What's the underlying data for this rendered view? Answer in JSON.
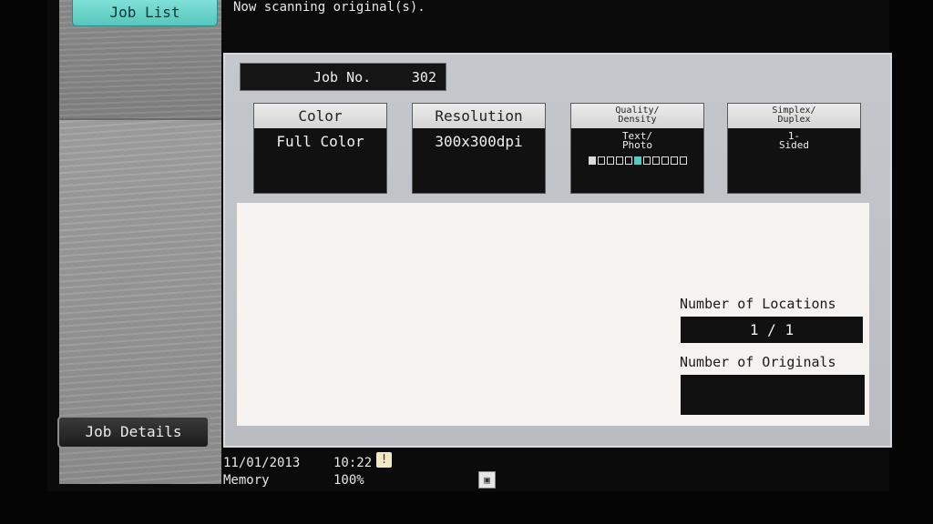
{
  "header": {
    "job_list_label": "Job List",
    "message": "Now scanning original(s)."
  },
  "job": {
    "label": "Job No.",
    "number": "302"
  },
  "settings": {
    "color": {
      "title": "Color",
      "value": "Full Color"
    },
    "resolution": {
      "title": "Resolution",
      "value": "300x300dpi"
    },
    "quality": {
      "title": "Quality/\nDensity",
      "value": "Text/\nPhoto"
    },
    "duplex": {
      "title": "Simplex/\nDuplex",
      "value": "1-\nSided"
    }
  },
  "density_level": {
    "steps": 11,
    "selected": 6
  },
  "locations": {
    "label": "Number of Locations",
    "value": "1 / 1"
  },
  "originals": {
    "label": "Number of Originals",
    "value": ""
  },
  "sidebar": {
    "job_details_label": "Job Details"
  },
  "status": {
    "date": "11/01/2013",
    "time": "10:22",
    "memory_label": "Memory",
    "memory_value": "100%"
  },
  "colors": {
    "accent": "#59c8c0"
  }
}
